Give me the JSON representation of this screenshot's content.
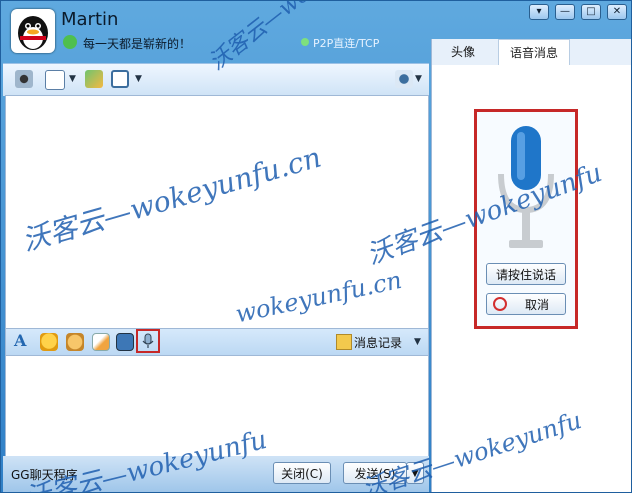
{
  "header": {
    "username": "Martin",
    "signature": "每一天都是崭新的！",
    "p2p_status": "P2P直连/TCP"
  },
  "window_controls": [
    "▾",
    "—",
    "□",
    "✕"
  ],
  "toolbar": {
    "icons": [
      "webcam-icon",
      "file-transfer-icon",
      "app-icon",
      "screen-share-icon",
      "mic-settings-icon"
    ]
  },
  "input_bar": {
    "font_label": "A",
    "history_label": "消息记录"
  },
  "footer": {
    "program_label": "GG聊天程序",
    "close_label": "关闭(C)",
    "send_label": "发送(S)",
    "send_dropdown": "▼"
  },
  "right_panel": {
    "tabs": [
      {
        "label": "头像"
      },
      {
        "label": "语音消息"
      }
    ],
    "press_to_talk_label": "请按住说话",
    "cancel_label": "取消"
  },
  "watermarks": [
    "沃客云—wokeyunfu.cn",
    "沃客云—wokeyunfu.cn",
    "wokeyunfu.cn",
    "沃客云—wokeyunfu",
    "沃客云—wokeyunfu",
    "沃客云—wokeyunfu"
  ],
  "colors": {
    "accent": "#2f7fc6",
    "highlight": "#c62828",
    "mic_blue": "#1f76c9"
  }
}
